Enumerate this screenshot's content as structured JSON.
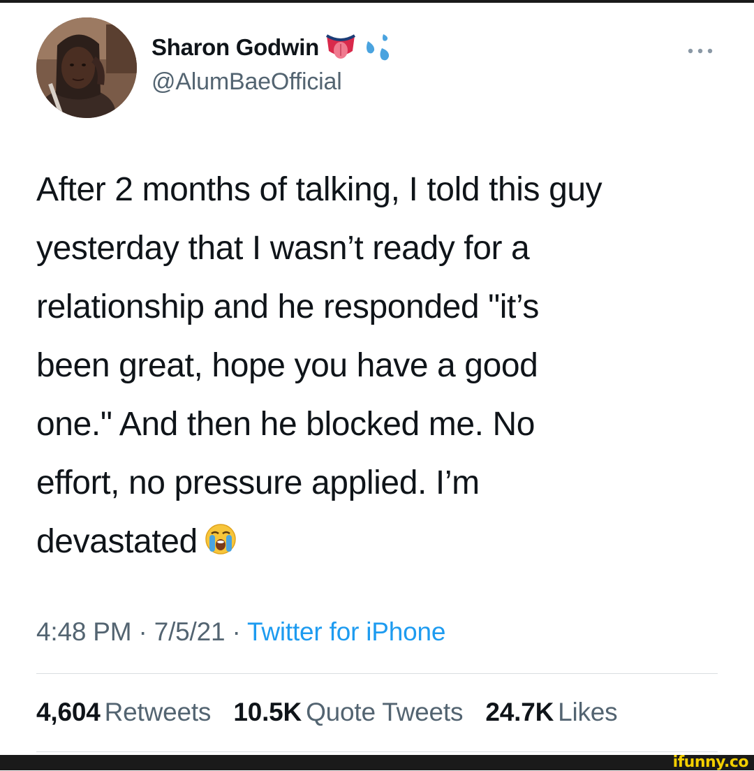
{
  "author": {
    "display_name": "Sharon Godwin",
    "handle": "@AlumBaeOfficial",
    "name_emojis": [
      "tongue-icon",
      "sweat-droplets-icon"
    ]
  },
  "menu": {
    "icon": "more-horizontal-icon"
  },
  "tweet": {
    "lines": [
      "After 2 months of talking, I told this guy",
      "yesterday that I wasn’t ready for a",
      "relationship and he responded \"it’s",
      "been great, hope you have a good",
      "one.\" And then he blocked me. No",
      "effort, no pressure applied. I’m",
      "devastated"
    ],
    "end_emoji": "loudly-crying-face-icon"
  },
  "meta": {
    "time": "4:48 PM",
    "separator": " · ",
    "date": "7/5/21",
    "source": "Twitter for iPhone"
  },
  "stats": {
    "retweets_count": "4,604",
    "retweets_label": "Retweets",
    "quotes_count": "10.5K",
    "quotes_label": "Quote Tweets",
    "likes_count": "24.7K",
    "likes_label": "Likes"
  },
  "watermark": {
    "text": "ifunny.co"
  },
  "colors": {
    "text_primary": "#0f1419",
    "text_secondary": "#536471",
    "link": "#1d9bf0",
    "watermark": "#f3cf00"
  }
}
